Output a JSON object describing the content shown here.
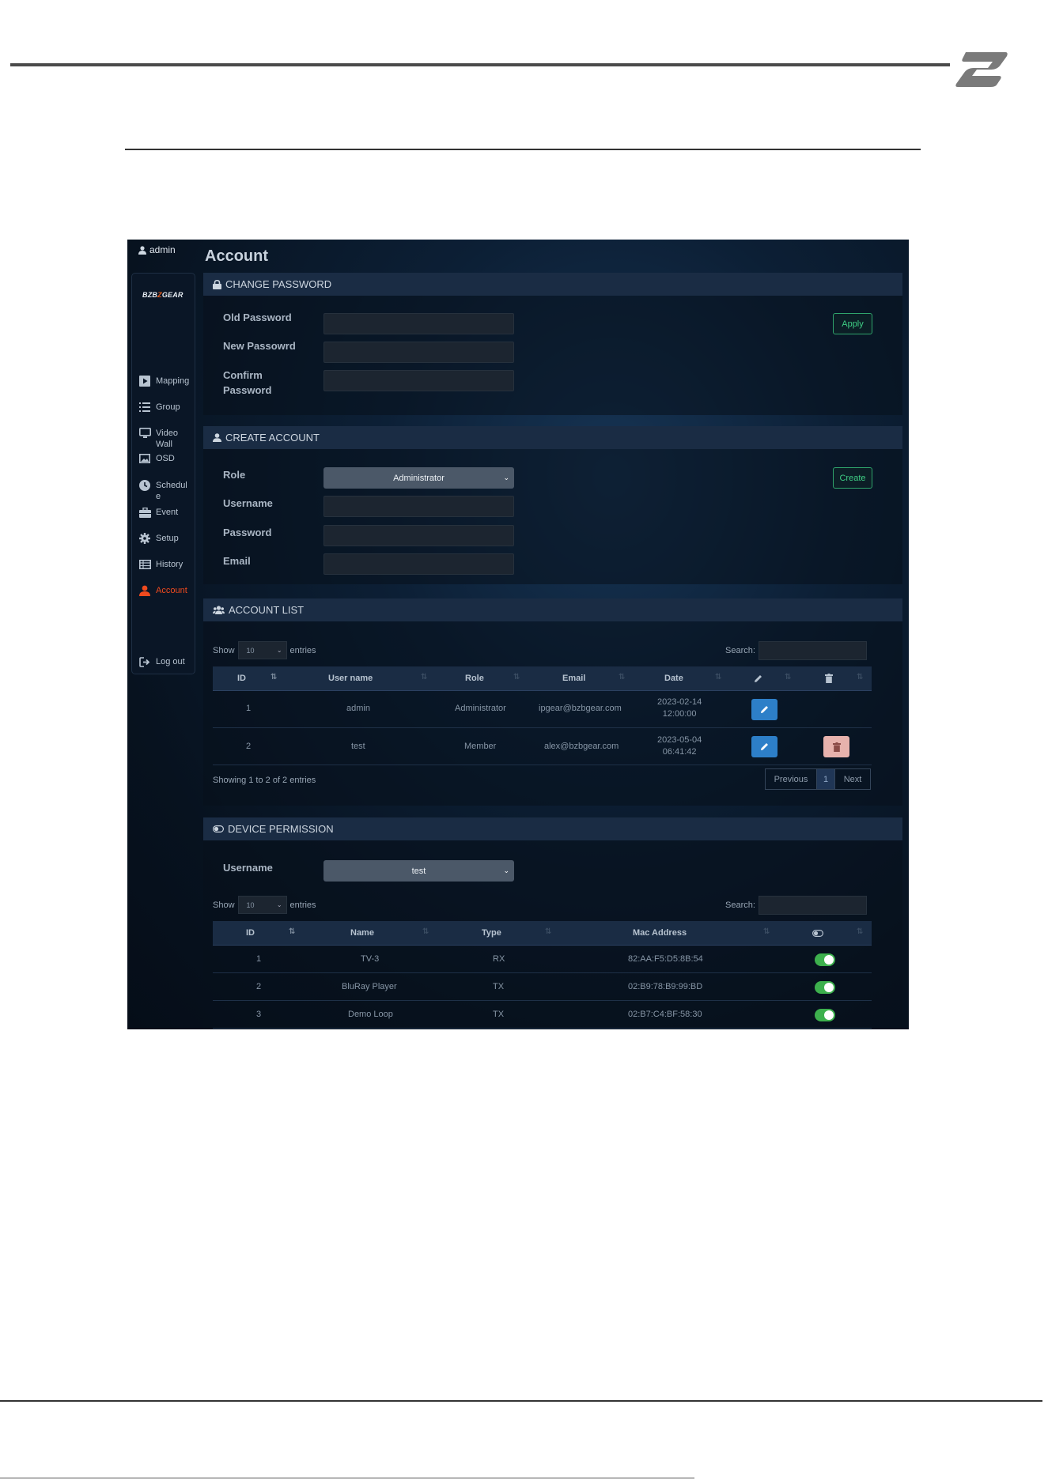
{
  "doc": {
    "logo": "Z"
  },
  "header": {
    "user": "admin",
    "page_title": "Account"
  },
  "sidebar": {
    "brand": {
      "left": "BZB",
      "mark": "Z",
      "right": "GEAR"
    },
    "items": [
      {
        "label": "Mapping",
        "icon": "play-square-icon"
      },
      {
        "label": "Group",
        "icon": "list-icon"
      },
      {
        "label": "Video Wall",
        "icon": "monitor-icon"
      },
      {
        "label": "OSD",
        "icon": "image-icon"
      },
      {
        "label": "Schedule",
        "icon": "clock-icon"
      },
      {
        "label": "Event",
        "icon": "briefcase-icon"
      },
      {
        "label": "Setup",
        "icon": "gear-icon"
      },
      {
        "label": "History",
        "icon": "table-icon"
      },
      {
        "label": "Account",
        "icon": "user-icon",
        "active": true
      },
      {
        "label": "Log out",
        "icon": "logout-icon"
      }
    ],
    "active_color": "#f04a1e"
  },
  "change_password": {
    "title": "CHANGE PASSWORD",
    "old_label": "Old Password",
    "new_label": "New Passowrd",
    "confirm_label_1": "Confirm",
    "confirm_label_2": "Password",
    "apply": "Apply"
  },
  "create_account": {
    "title": "CREATE ACCOUNT",
    "role_label": "Role",
    "role_value": "Administrator",
    "username_label": "Username",
    "password_label": "Password",
    "email_label": "Email",
    "create": "Create"
  },
  "account_list": {
    "title": "ACCOUNT LIST",
    "show": "Show",
    "entries_value": "10",
    "entries": "entries",
    "search": "Search:",
    "columns": [
      "ID",
      "User name",
      "Role",
      "Email",
      "Date"
    ],
    "rows": [
      {
        "id": "1",
        "username": "admin",
        "role": "Administrator",
        "email": "ipgear@bzbgear.com",
        "date": "2023-02-14",
        "time": "12:00:00",
        "deletable": false
      },
      {
        "id": "2",
        "username": "test",
        "role": "Member",
        "email": "alex@bzbgear.com",
        "date": "2023-05-04",
        "time": "06:41:42",
        "deletable": true
      }
    ],
    "info": "Showing 1 to 2 of 2 entries",
    "prev": "Previous",
    "page": "1",
    "next": "Next"
  },
  "device_permission": {
    "title": "DEVICE PERMISSION",
    "username_label": "Username",
    "username_value": "test",
    "show": "Show",
    "entries_value": "10",
    "entries": "entries",
    "search": "Search:",
    "columns": [
      "ID",
      "Name",
      "Type",
      "Mac Address"
    ],
    "rows": [
      {
        "id": "1",
        "name": "TV-3",
        "type": "RX",
        "mac": "82:AA:F5:D5:8B:54",
        "enabled": true
      },
      {
        "id": "2",
        "name": "BluRay Player",
        "type": "TX",
        "mac": "02:B9:78:B9:99:BD",
        "enabled": true
      },
      {
        "id": "3",
        "name": "Demo Loop",
        "type": "TX",
        "mac": "02:B7:C4:BF:58:30",
        "enabled": true
      }
    ]
  }
}
